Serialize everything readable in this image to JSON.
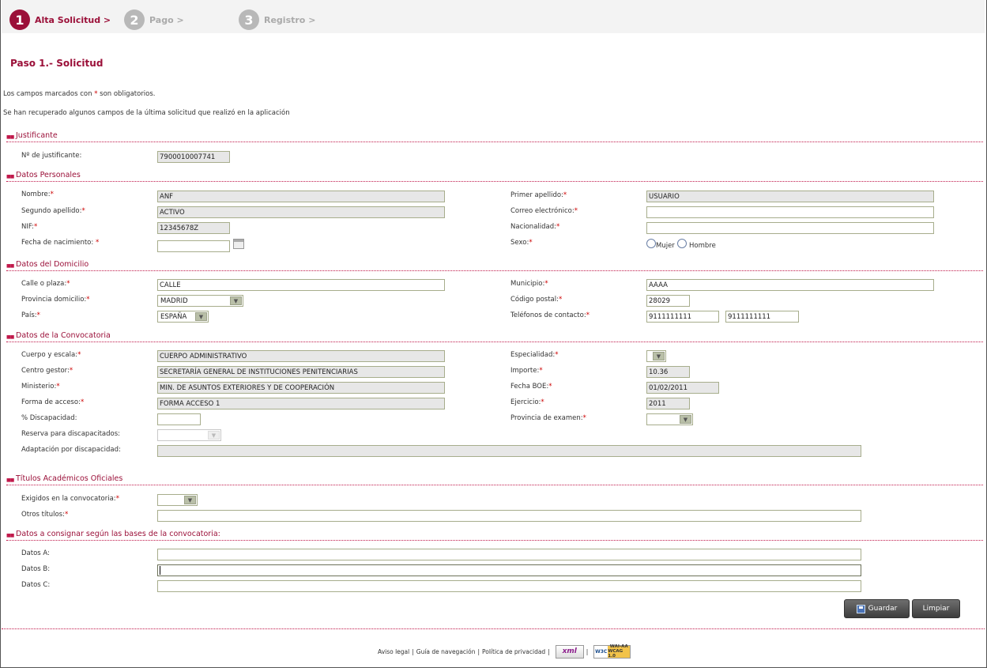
{
  "steps": [
    {
      "num": "1",
      "label": "Alta Solicitud >"
    },
    {
      "num": "2",
      "label": "Pago >"
    },
    {
      "num": "3",
      "label": "Registro >"
    }
  ],
  "title": "Paso 1.- Solicitud",
  "notes": {
    "required_prefix": "Los campos marcados con",
    "required_star": "*",
    "required_suffix": "son obligatorios.",
    "recovered": "Se han recuperado algunos campos de la última solicitud que realizó en la aplicación"
  },
  "sections": {
    "justificante": "Justificante",
    "personales": "Datos Personales",
    "domicilio": "Datos del Domicilio",
    "convocatoria": "Datos de la Convocatoria",
    "titulos": "Títulos Académicos Oficiales",
    "consignar": "Datos a consignar según las bases de la convocatoria:"
  },
  "star": "*",
  "justificante": {
    "label": "Nº de justificante:",
    "value": "7900010007741"
  },
  "personales": {
    "nombre": {
      "label": "Nombre:",
      "value": "ANF"
    },
    "segundo": {
      "label": "Segundo apellido:",
      "value": "ACTIVO"
    },
    "nif": {
      "label": "NIF:",
      "value": "12345678Z"
    },
    "nacimiento": {
      "label": "Fecha de nacimiento:",
      "value": ""
    },
    "primer": {
      "label": "Primer apellido:",
      "value": "USUARIO"
    },
    "correo": {
      "label": "Correo electrónico:",
      "value": ""
    },
    "nacionalidad": {
      "label": "Nacionalidad:",
      "value": ""
    },
    "sexo": {
      "label": "Sexo:",
      "mujer": "Mujer",
      "hombre": "Hombre"
    }
  },
  "domicilio": {
    "calle": {
      "label": "Calle o plaza:",
      "value": "CALLE"
    },
    "provincia": {
      "label": "Provincia domicilio:",
      "value": "MADRID"
    },
    "pais": {
      "label": "País:",
      "value": "ESPAÑA"
    },
    "municipio": {
      "label": "Municipio:",
      "value": "AAAA"
    },
    "cp": {
      "label": "Código postal:",
      "value": "28029"
    },
    "telefonos": {
      "label": "Teléfonos de contacto:",
      "tel1": "9111111111",
      "tel2": "9111111111"
    }
  },
  "convocatoria": {
    "cuerpo": {
      "label": "Cuerpo y escala:",
      "value": "CUERPO ADMINISTRATIVO"
    },
    "centro": {
      "label": "Centro gestor:",
      "value": "SECRETARÍA GENERAL DE INSTITUCIONES PENITENCIARIAS"
    },
    "ministerio": {
      "label": "Ministerio:",
      "value": "MIN. DE ASUNTOS EXTERIORES Y DE COOPERACIÓN"
    },
    "acceso": {
      "label": "Forma de acceso:",
      "value": "FORMA ACCESO 1"
    },
    "discapacidad": {
      "label": "% Discapacidad:",
      "value": ""
    },
    "reserva": {
      "label": "Reserva para discapacitados:",
      "value": ""
    },
    "adaptacion": {
      "label": "Adaptación por discapacidad:",
      "value": ""
    },
    "especialidad": {
      "label": "Especialidad:",
      "value": ""
    },
    "importe": {
      "label": "Importe:",
      "value": "10.36"
    },
    "boe": {
      "label": "Fecha BOE:",
      "value": "01/02/2011"
    },
    "ejercicio": {
      "label": "Ejercicio:",
      "value": "2011"
    },
    "provincia_examen": {
      "label": "Provincia de examen:",
      "value": ""
    }
  },
  "titulos": {
    "exigidos": {
      "label": "Exigidos en la convocatoria:",
      "value": ""
    },
    "otros": {
      "label": "Otros títulos:",
      "value": ""
    }
  },
  "consignar": {
    "a": {
      "label": "Datos A:",
      "value": ""
    },
    "b": {
      "label": "Datos B:",
      "value": ""
    },
    "c": {
      "label": "Datos C:",
      "value": ""
    }
  },
  "buttons": {
    "guardar": "Guardar",
    "limpiar": "Limpiar"
  },
  "footer": {
    "aviso": "Aviso legal",
    "guia": "Guía de navegación",
    "privacidad": "Política de privacidad",
    "sep": "|",
    "xml_badge": "xml",
    "w3c_badge": "W3C",
    "wai_badge": "WAI-AA",
    "wcag_badge": "WCAG 1.0"
  },
  "colors": {
    "accent": "#9b1039",
    "required": "#cc0000",
    "readonly_bg": "#e7e7e7"
  }
}
